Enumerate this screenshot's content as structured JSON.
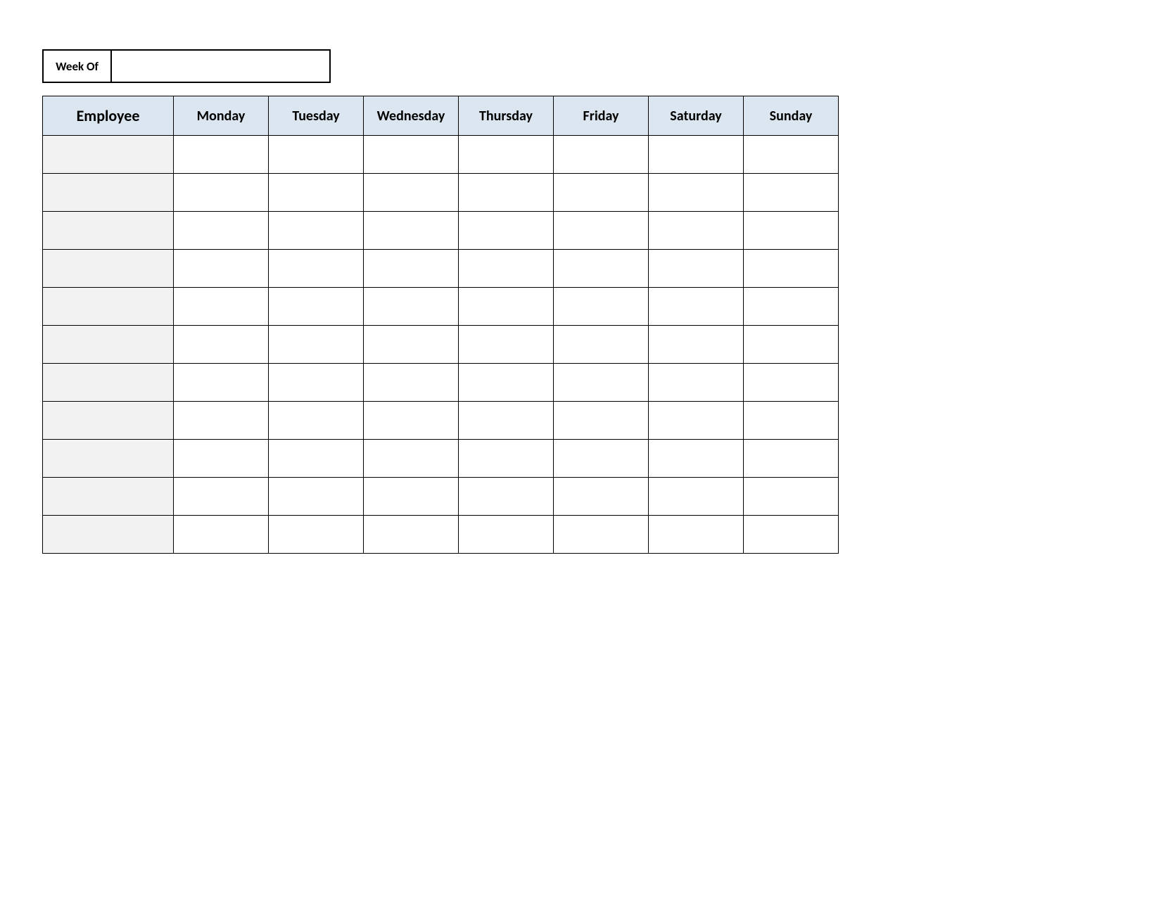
{
  "week_of": {
    "label": "Week Of",
    "value": ""
  },
  "schedule": {
    "columns": [
      "Employee",
      "Monday",
      "Tuesday",
      "Wednesday",
      "Thursday",
      "Friday",
      "Saturday",
      "Sunday"
    ],
    "rows": [
      {
        "employee": "",
        "days": [
          "",
          "",
          "",
          "",
          "",
          "",
          ""
        ]
      },
      {
        "employee": "",
        "days": [
          "",
          "",
          "",
          "",
          "",
          "",
          ""
        ]
      },
      {
        "employee": "",
        "days": [
          "",
          "",
          "",
          "",
          "",
          "",
          ""
        ]
      },
      {
        "employee": "",
        "days": [
          "",
          "",
          "",
          "",
          "",
          "",
          ""
        ]
      },
      {
        "employee": "",
        "days": [
          "",
          "",
          "",
          "",
          "",
          "",
          ""
        ]
      },
      {
        "employee": "",
        "days": [
          "",
          "",
          "",
          "",
          "",
          "",
          ""
        ]
      },
      {
        "employee": "",
        "days": [
          "",
          "",
          "",
          "",
          "",
          "",
          ""
        ]
      },
      {
        "employee": "",
        "days": [
          "",
          "",
          "",
          "",
          "",
          "",
          ""
        ]
      },
      {
        "employee": "",
        "days": [
          "",
          "",
          "",
          "",
          "",
          "",
          ""
        ]
      },
      {
        "employee": "",
        "days": [
          "",
          "",
          "",
          "",
          "",
          "",
          ""
        ]
      },
      {
        "employee": "",
        "days": [
          "",
          "",
          "",
          "",
          "",
          "",
          ""
        ]
      }
    ]
  },
  "colors": {
    "header_bg": "#dbe6f1",
    "employee_col_bg": "#f2f2f2",
    "border": "#000000"
  }
}
